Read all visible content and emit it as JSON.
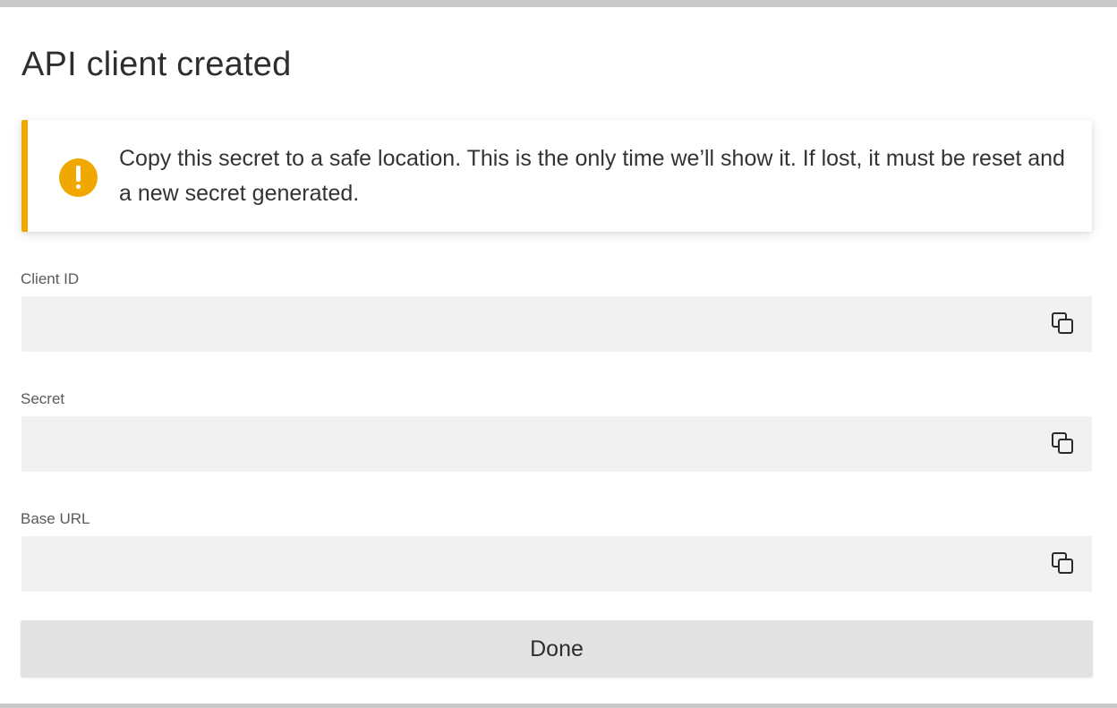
{
  "dialog": {
    "title": "API client created",
    "alert": {
      "icon": "warning-exclamation-icon",
      "message": "Copy this secret to a safe location. This is the only time we’ll show it. If lost, it must be reset and a new secret generated.",
      "accent_color": "#f0a800"
    },
    "fields": [
      {
        "label": "Client ID",
        "value": "",
        "copy_icon": "copy-icon"
      },
      {
        "label": "Secret",
        "value": "",
        "copy_icon": "copy-icon"
      },
      {
        "label": "Base URL",
        "value": "",
        "copy_icon": "copy-icon"
      }
    ],
    "done_label": "Done"
  }
}
